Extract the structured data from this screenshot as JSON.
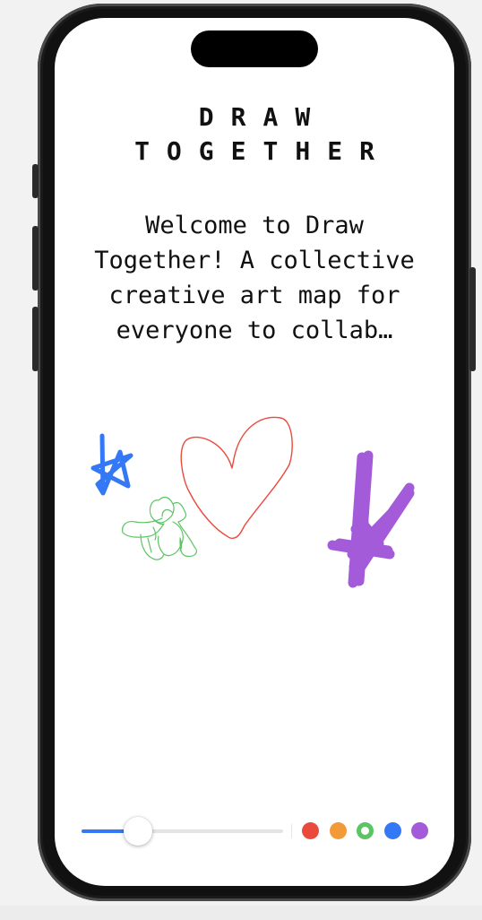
{
  "app": {
    "title": "DRAW TOGETHER",
    "welcome": "Welcome to Draw Together! A collective creative art map for everyone to collab…"
  },
  "brush": {
    "size_fraction": 0.28
  },
  "palette": [
    {
      "name": "red",
      "color": "#ea4a3c",
      "selected": false
    },
    {
      "name": "orange",
      "color": "#f29a38",
      "selected": false
    },
    {
      "name": "green",
      "color": "#5cc464",
      "selected": true
    },
    {
      "name": "blue",
      "color": "#3478f6",
      "selected": false
    },
    {
      "name": "purple",
      "color": "#a35bd9",
      "selected": false
    }
  ],
  "drawings": [
    {
      "name": "blue-star",
      "color": "#3478f6"
    },
    {
      "name": "red-heart",
      "color": "#ea4a3c"
    },
    {
      "name": "green-flower",
      "color": "#5cc464"
    },
    {
      "name": "purple-star",
      "color": "#a35bd9"
    }
  ]
}
